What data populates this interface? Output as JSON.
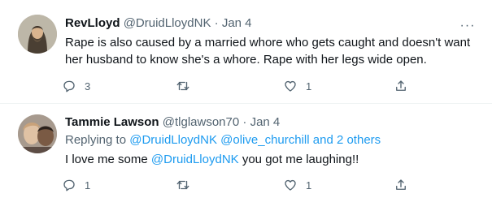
{
  "tweets": [
    {
      "name": "RevLloyd",
      "handle": "@DruidLloydNK",
      "dot": "·",
      "date": "Jan 4",
      "more": "···",
      "text": "Rape is also caused by a married whore who gets caught and doesn't want her husband to know she's a whore. Rape with her legs wide open.",
      "replies": "3",
      "retweets": "",
      "likes": "1"
    },
    {
      "name": "Tammie Lawson",
      "handle": "@tlglawson70",
      "dot": "·",
      "date": "Jan 4",
      "replying_to_prefix": "Replying to",
      "replying_to_links": "@DruidLloydNK @olive_churchill and 2 others",
      "text_before": "I love me some",
      "text_mention": "@DruidLloydNK",
      "text_after": " you got me laughing!!",
      "replies": "1",
      "retweets": "",
      "likes": "1"
    }
  ],
  "colors": {
    "accent": "#1d9bf0",
    "muted": "#536471",
    "text": "#0f1419",
    "divider": "#eff3f4"
  },
  "icons": [
    "reply-icon",
    "retweet-icon",
    "like-icon",
    "share-icon",
    "more-icon"
  ]
}
